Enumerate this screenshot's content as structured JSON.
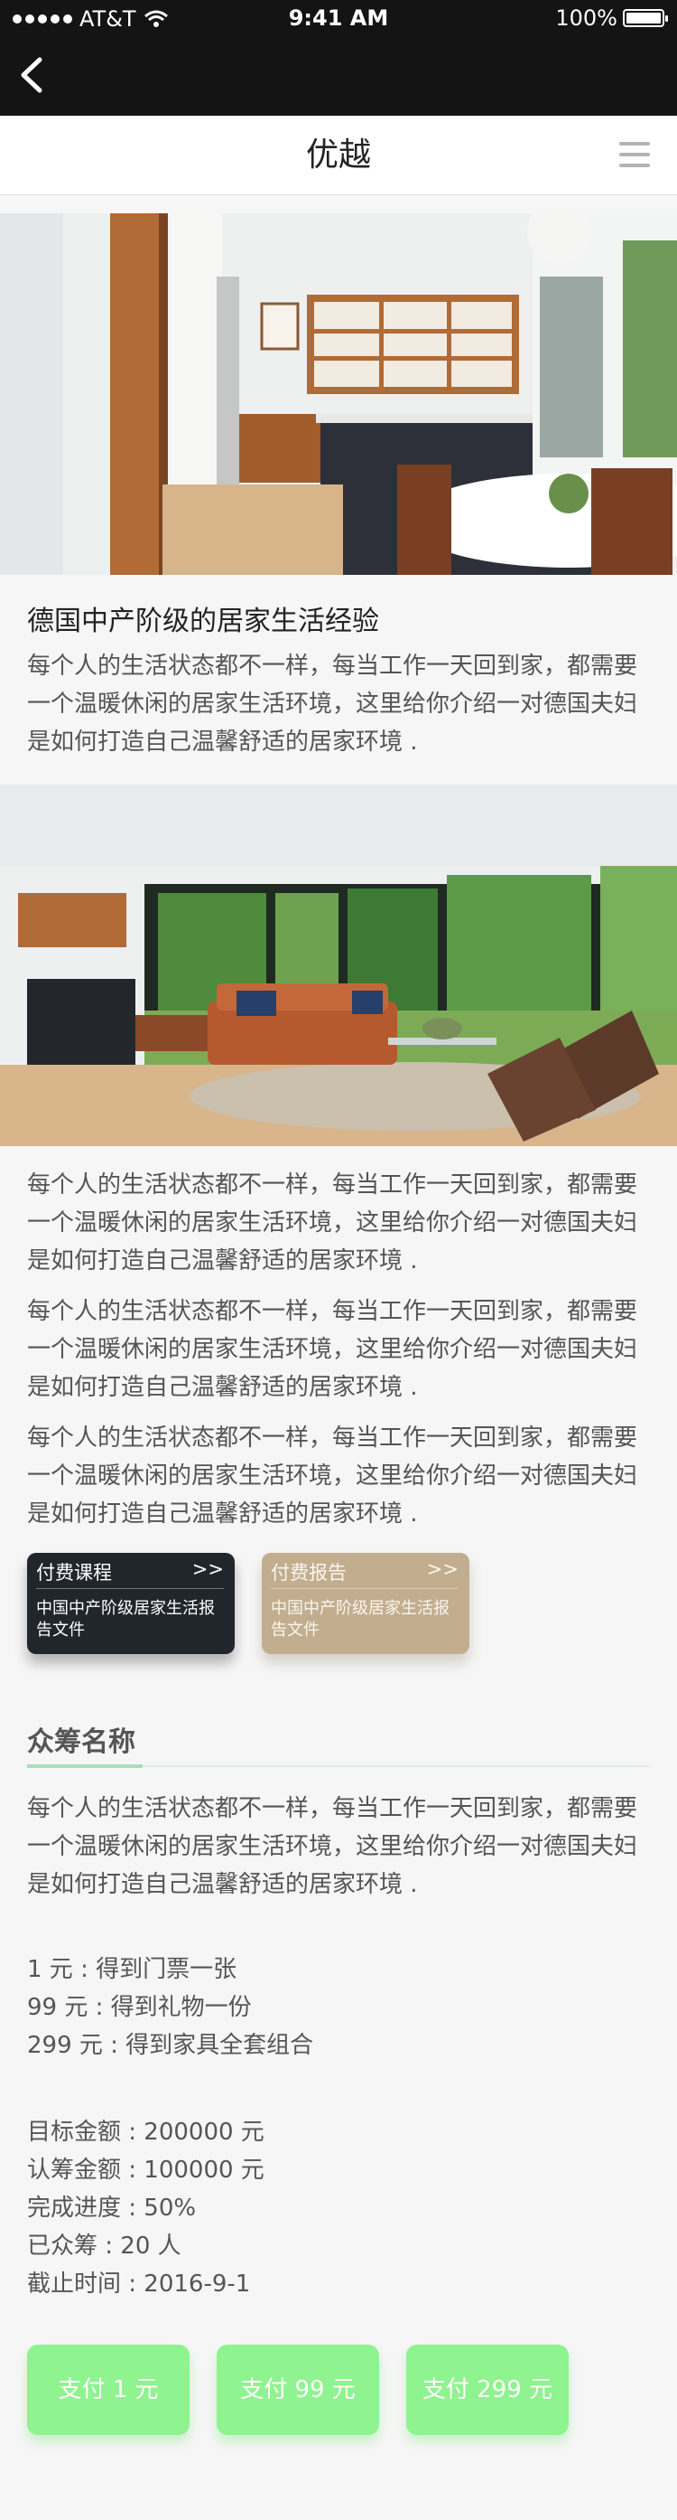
{
  "status": {
    "carrier": "AT&T",
    "time": "9:41 AM",
    "battery": "100%"
  },
  "nav": {
    "title": "优越"
  },
  "article": {
    "heading": "德国中产阶级的居家生活经验",
    "intro": "每个人的生活状态都不一样，每当工作一天回到家，都需要一个温暖休闲的居家生活环境，这里给你介绍一对德国夫妇是如何打造自己温馨舒适的居家环境 .",
    "paragraphs": [
      "每个人的生活状态都不一样，每当工作一天回到家，都需要一个温暖休闲的居家生活环境，这里给你介绍一对德国夫妇是如何打造自己温馨舒适的居家环境 .",
      "每个人的生活状态都不一样，每当工作一天回到家，都需要一个温暖休闲的居家生活环境，这里给你介绍一对德国夫妇是如何打造自己温馨舒适的居家环境 .",
      "每个人的生活状态都不一样，每当工作一天回到家，都需要一个温暖休闲的居家生活环境，这里给你介绍一对德国夫妇是如何打造自己温馨舒适的居家环境 ."
    ]
  },
  "cards": [
    {
      "title": "付费课程",
      "arrow": ">>",
      "desc": "中国中产阶级居家生活报告文件",
      "color": "#20262b"
    },
    {
      "title": "付费报告",
      "arrow": ">>",
      "desc": "中国中产阶级居家生活报告文件",
      "color": "#c2ae8f"
    }
  ],
  "crowdfunding": {
    "title": "众筹名称",
    "description": "每个人的生活状态都不一样，每当工作一天回到家，都需要一个温暖休闲的居家生活环境，这里给你介绍一对德国夫妇是如何打造自己温馨舒适的居家环境 .",
    "rewards": [
      "1 元 : 得到门票一张",
      "99 元 : 得到礼物一份",
      "299 元 : 得到家具全套组合"
    ],
    "stats": [
      "目标金额 : 200000 元",
      "认筹金额 : 100000 元",
      "完成进度 : 50%",
      "已众筹 : 20 人",
      "截止时间 : 2016-9-1"
    ]
  },
  "pay_buttons": [
    "支付 1 元",
    "支付 99 元",
    "支付 299 元"
  ],
  "colors": {
    "accent_green": "#8ff38f",
    "header_black": "#141414",
    "tan": "#c2ae8f"
  }
}
